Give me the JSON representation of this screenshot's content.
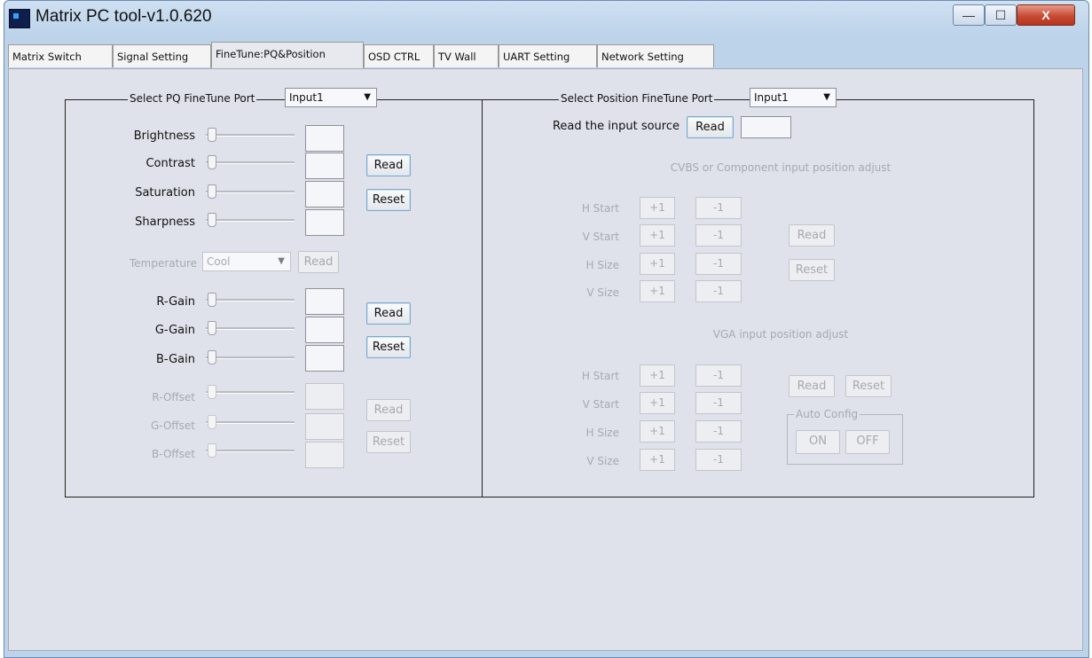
{
  "window": {
    "title": "Matrix PC tool-v1.0.620",
    "minimize": "—",
    "maximize": "☐",
    "close": "X"
  },
  "tabs": [
    {
      "label": "Matrix Switch"
    },
    {
      "label": "Signal Setting"
    },
    {
      "label": "FineTune:PQ&Position",
      "active": true
    },
    {
      "label": "OSD CTRL"
    },
    {
      "label": "TV Wall"
    },
    {
      "label": "UART Setting"
    },
    {
      "label": "Network Setting"
    }
  ],
  "pq": {
    "legend": "Select PQ FineTune Port",
    "port": "Input1",
    "sliders": {
      "brightness": "Brightness",
      "contrast": "Contrast",
      "saturation": "Saturation",
      "sharpness": "Sharpness",
      "r_gain": "R-Gain",
      "g_gain": "G-Gain",
      "b_gain": "B-Gain",
      "r_offset": "R-Offset",
      "g_offset": "G-Offset",
      "b_offset": "B-Offset"
    },
    "temperature_label": "Temperature",
    "temperature_value": "Cool",
    "read": "Read",
    "reset": "Reset"
  },
  "position": {
    "legend": "Select Position FineTune Port",
    "port": "Input1",
    "read_source_label": "Read the input source",
    "read": "Read",
    "reset": "Reset",
    "cvbs_title": "CVBS or Component input position adjust",
    "vga_title": "VGA input position adjust",
    "h_start": "H Start",
    "v_start": "V Start",
    "h_size": "H Size",
    "v_size": "V Size",
    "plus": "+1",
    "minus": "-1",
    "auto_config": "Auto Config",
    "on": "ON",
    "off": "OFF"
  },
  "colors": {
    "accent_border": "#7ea6c8",
    "client_bg": "#dfe2ea",
    "disabled_text": "#a7a9ae"
  }
}
